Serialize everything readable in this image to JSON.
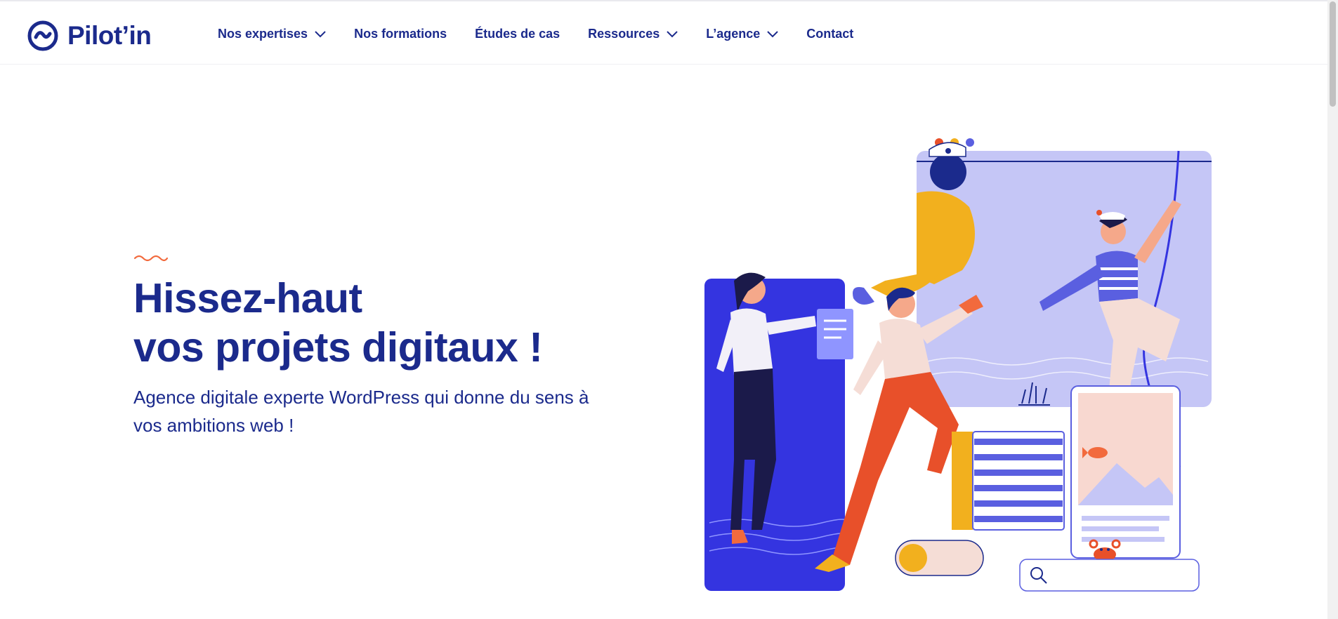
{
  "brand": {
    "name": "Pilot’in"
  },
  "nav": {
    "items": [
      {
        "label": "Nos expertises",
        "has_dropdown": true
      },
      {
        "label": "Nos formations",
        "has_dropdown": false
      },
      {
        "label": "Études de cas",
        "has_dropdown": false
      },
      {
        "label": "Ressources",
        "has_dropdown": true
      },
      {
        "label": "L’agence",
        "has_dropdown": true
      },
      {
        "label": "Contact",
        "has_dropdown": false
      }
    ]
  },
  "hero": {
    "title_line1": "Hissez-haut",
    "title_line2": "vos projets digitaux !",
    "subtitle": "Agence digitale experte WordPress qui donne du sens à vos ambitions web !"
  },
  "colors": {
    "brand_navy": "#1b2a8c",
    "accent_orange": "#f26a3d",
    "lavender": "#c5c6f6",
    "royal_blue": "#3434e0",
    "mustard": "#f2b01e"
  }
}
